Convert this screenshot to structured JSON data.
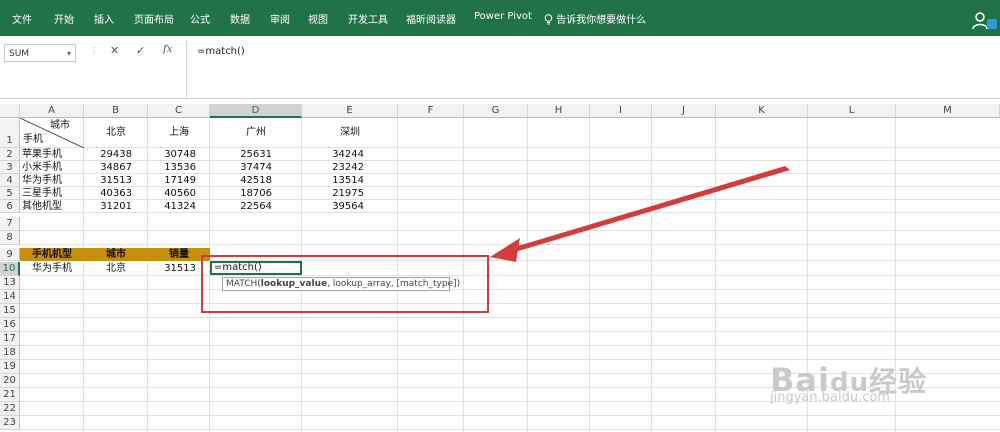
{
  "ribbon": {
    "tabs": [
      "文件",
      "开始",
      "插入",
      "页面布局",
      "公式",
      "数据",
      "审阅",
      "视图",
      "开发工具",
      "福昕阅读器",
      "Power Pivot"
    ],
    "tell_me": "告诉我你想要做什么",
    "color": "#217346"
  },
  "formula_bar": {
    "name_box": "SUM",
    "cancel": "✕",
    "enter": "✓",
    "fx": "fx",
    "content": "=match()"
  },
  "columns": [
    "A",
    "B",
    "C",
    "D",
    "E",
    "F",
    "G",
    "H",
    "I",
    "J",
    "K",
    "L",
    "M"
  ],
  "selected_column": "D",
  "rows": [
    "1",
    "2",
    "3",
    "4",
    "5",
    "6",
    "7",
    "8",
    "9",
    "10",
    "13",
    "14",
    "15",
    "16",
    "17",
    "18",
    "19",
    "20",
    "21",
    "22",
    "23"
  ],
  "selected_row": "10",
  "table1": {
    "corner_top": "城市",
    "corner_bottom": "手机",
    "headers": [
      "北京",
      "上海",
      "广州",
      "深圳"
    ],
    "rows": [
      {
        "name": "苹果手机",
        "values": [
          "29438",
          "30748",
          "25631",
          "34244"
        ]
      },
      {
        "name": "小米手机",
        "values": [
          "34867",
          "13536",
          "37474",
          "23242"
        ]
      },
      {
        "name": "华为手机",
        "values": [
          "31513",
          "17149",
          "42518",
          "13514"
        ]
      },
      {
        "name": "三星手机",
        "values": [
          "40363",
          "40560",
          "18706",
          "21975"
        ]
      },
      {
        "name": "其他机型",
        "values": [
          "31201",
          "41324",
          "22564",
          "39564"
        ]
      }
    ]
  },
  "table2": {
    "headers": [
      "手机机型",
      "城市",
      "销量"
    ],
    "row": [
      "华为手机",
      "北京",
      "31513"
    ],
    "header_color": "#c8900a"
  },
  "active_cell": {
    "ref": "D10",
    "value": "=match()"
  },
  "tooltip": {
    "prefix": "MATCH(",
    "bold_arg": "lookup_value",
    "rest": ", lookup_array, [match_type])"
  },
  "annotation_color": "#d43c3c",
  "watermark": {
    "logo": "Bai",
    "logo2": "du",
    "logo3": "经验",
    "url": "jingyan.baidu.com"
  }
}
